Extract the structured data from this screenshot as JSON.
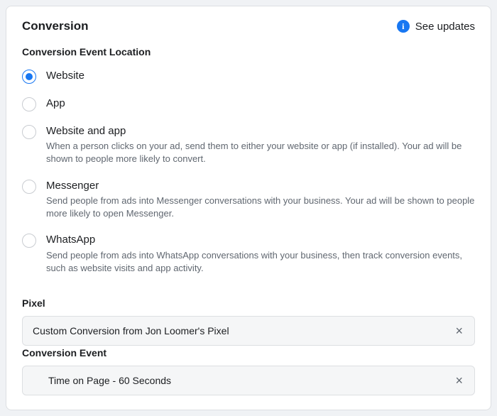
{
  "header": {
    "title": "Conversion",
    "see_updates": "See updates"
  },
  "location": {
    "label": "Conversion Event Location",
    "options": {
      "website": {
        "label": "Website"
      },
      "app": {
        "label": "App"
      },
      "website_app": {
        "label": "Website and app",
        "desc": "When a person clicks on your ad, send them to either your website or app (if installed). Your ad will be shown to people more likely to convert."
      },
      "messenger": {
        "label": "Messenger",
        "desc": "Send people from ads into Messenger conversations with your business. Your ad will be shown to people more likely to open Messenger."
      },
      "whatsapp": {
        "label": "WhatsApp",
        "desc": "Send people from ads into WhatsApp conversations with your business, then track conversion events, such as website visits and app activity."
      }
    }
  },
  "pixel": {
    "label": "Pixel",
    "value": "Custom Conversion from Jon Loomer's Pixel"
  },
  "event": {
    "label": "Conversion Event",
    "value": "Time on Page - 60 Seconds"
  }
}
